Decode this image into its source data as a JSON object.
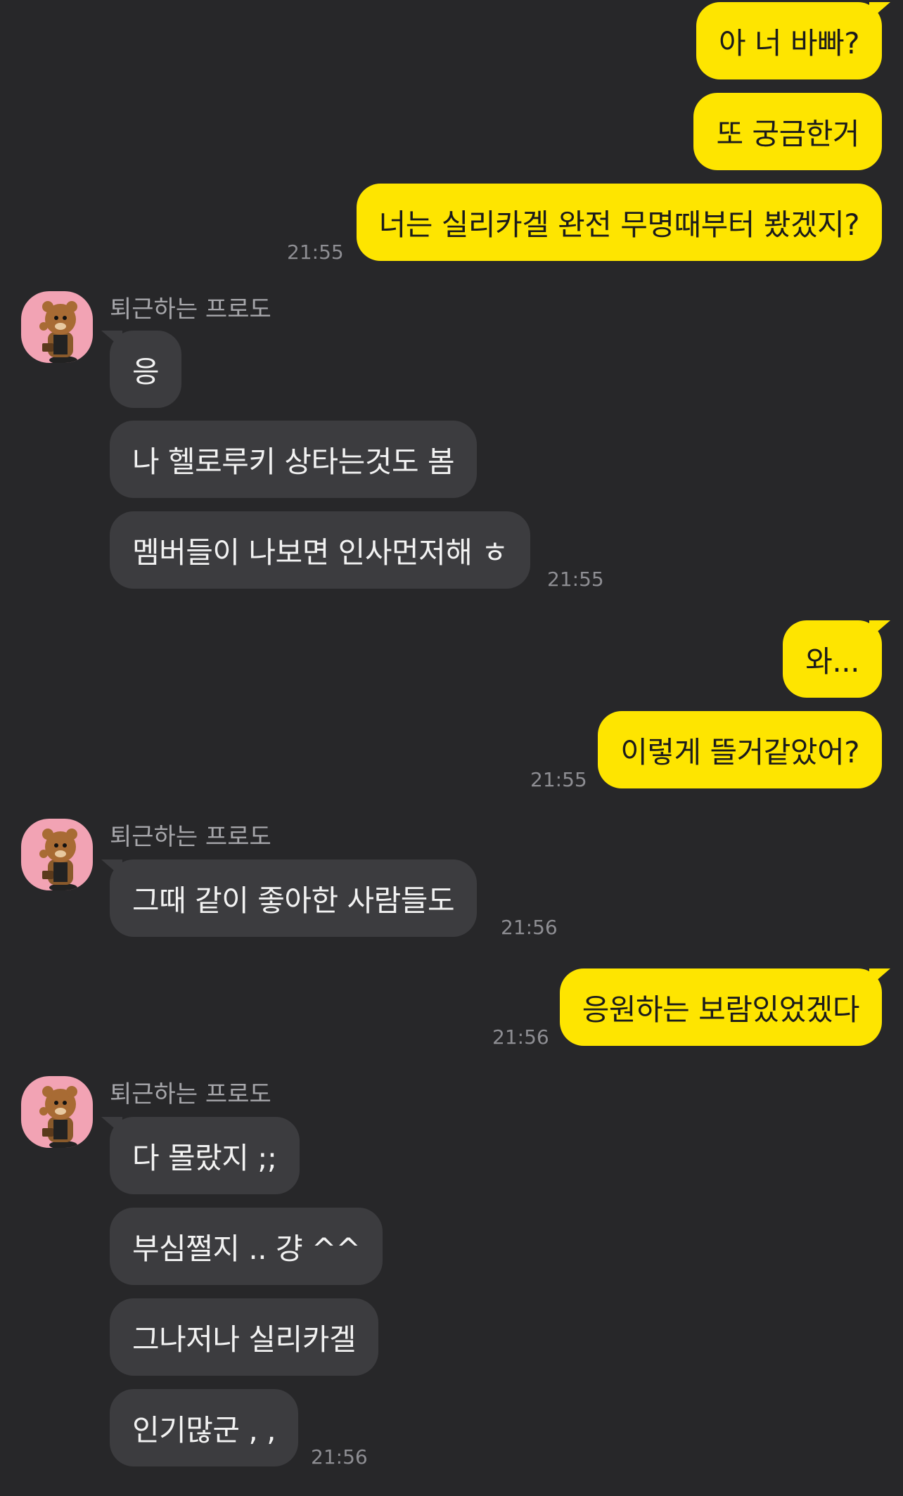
{
  "chat": {
    "sender_name": "퇴근하는 프로도",
    "messages": [
      {
        "from": "me",
        "text": "아 너 바빠?"
      },
      {
        "from": "me",
        "text": "또 궁금한거"
      },
      {
        "from": "me",
        "text": "너는 실리카겔 완전 무명때부터 봤겠지?",
        "time": "21:55"
      },
      {
        "from": "them",
        "text": "응"
      },
      {
        "from": "them",
        "text": "나 헬로루키 상타는것도 봄"
      },
      {
        "from": "them",
        "text": "멤버들이 나보면 인사먼저해 ㅎ",
        "time": "21:55"
      },
      {
        "from": "me",
        "text": "와..."
      },
      {
        "from": "me",
        "text": "이렇게 뜰거같았어?",
        "time": "21:55"
      },
      {
        "from": "them",
        "text": "그때 같이 좋아한 사람들도",
        "time": "21:56"
      },
      {
        "from": "me",
        "text": "응원하는 보람있었겠다",
        "time": "21:56"
      },
      {
        "from": "them",
        "text": "다 몰랐지 ;;"
      },
      {
        "from": "them",
        "text": "부심쩔지 .. 걍 ^^"
      },
      {
        "from": "them",
        "text": "그나저나 실리카겔"
      },
      {
        "from": "them",
        "text": "인기많군 , ,",
        "time": "21:56"
      }
    ]
  },
  "colors": {
    "background": "#272729",
    "my_bubble": "#FEE500",
    "their_bubble": "#3c3c3f",
    "avatar_bg": "#F2A3B4"
  },
  "icons": {
    "avatar": "frodo-character-icon"
  }
}
